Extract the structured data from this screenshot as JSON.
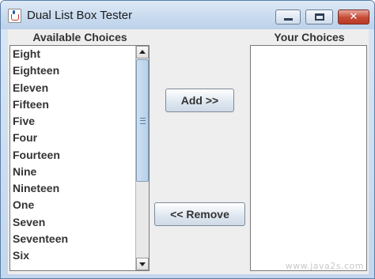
{
  "window": {
    "title": "Dual List Box Tester",
    "icon": "java-cup-icon",
    "controls": {
      "minimize": "minimize-icon",
      "maximize": "maximize-icon",
      "close_glyph": "✕"
    }
  },
  "available": {
    "label": "Available Choices",
    "items": [
      "Eight",
      "Eighteen",
      "Eleven",
      "Fifteen",
      "Five",
      "Four",
      "Fourteen",
      "Nine",
      "Nineteen",
      "One",
      "Seven",
      "Seventeen",
      "Six"
    ]
  },
  "chosen": {
    "label": "Your Choices",
    "items": []
  },
  "buttons": {
    "add": "Add >>",
    "remove": "<< Remove"
  },
  "watermark": "www.java2s.com",
  "colors": {
    "title_bar": "#c9dbef",
    "panel": "#eeeeee",
    "scroll_thumb": "#b8d0ea",
    "close_button": "#c54a35"
  }
}
